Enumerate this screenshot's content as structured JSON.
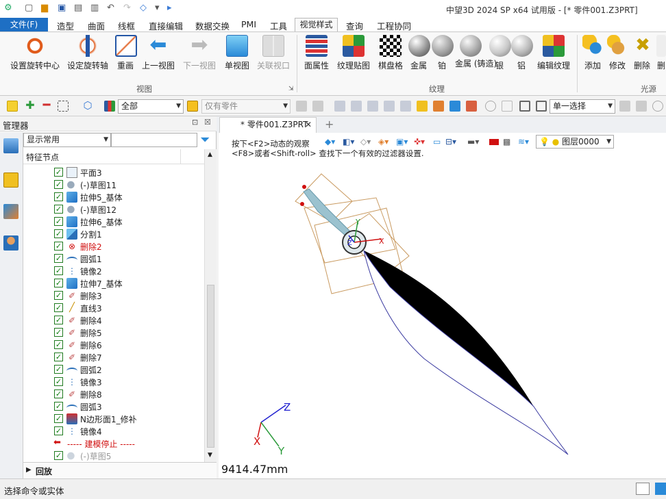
{
  "window": {
    "title": "中望3D 2024 SP x64 试用版 - [* 零件001.Z3PRT]"
  },
  "menu": {
    "file": "文件(F)",
    "items": [
      "造型",
      "曲面",
      "线框",
      "直接编辑",
      "数据交换",
      "PMI",
      "工具",
      "视觉样式",
      "查询",
      "工程协同"
    ],
    "active": "视觉样式"
  },
  "ribbon": {
    "view_group": {
      "label": "视图",
      "buttons": [
        "设置旋转中心",
        "设定旋转轴",
        "重画",
        "上一视图",
        "下一视图",
        "单视图",
        "关联视口"
      ]
    },
    "texture_group": {
      "label": "纹理",
      "buttons": [
        "面属性",
        "纹理贴图",
        "棋盘格",
        "金属",
        "铂",
        "金属 (铸造)",
        "银",
        "铝",
        "编辑纹理"
      ]
    },
    "light_group": {
      "label": "光源",
      "buttons": [
        "添加",
        "修改",
        "删除",
        "删"
      ]
    }
  },
  "toolbar": {
    "filter_value": "全部",
    "part_filter": "仅有零件",
    "select_mode": "单一选择"
  },
  "manager": {
    "title": "管理器",
    "display_filter": "显示常用",
    "tree_header": "特征节点",
    "nodes": [
      {
        "label": "平面3",
        "icon": "plane-icon",
        "red": false
      },
      {
        "label": "(-)草图11",
        "icon": "sketch-icon",
        "red": false
      },
      {
        "label": "拉伸5_基体",
        "icon": "extrude-icon",
        "red": false
      },
      {
        "label": "(-)草图12",
        "icon": "sketch-icon",
        "red": false
      },
      {
        "label": "拉伸6_基体",
        "icon": "extrude-icon",
        "red": false
      },
      {
        "label": "分割1",
        "icon": "split-icon",
        "red": false
      },
      {
        "label": "删除2",
        "icon": "delete-error-icon",
        "red": true
      },
      {
        "label": "圆弧1",
        "icon": "arc-icon",
        "red": false
      },
      {
        "label": "镜像2",
        "icon": "mirror-icon",
        "red": false
      },
      {
        "label": "拉伸7_基体",
        "icon": "extrude-icon",
        "red": false
      },
      {
        "label": "删除3",
        "icon": "delete-icon",
        "red": false
      },
      {
        "label": "直线3",
        "icon": "line-icon",
        "red": false
      },
      {
        "label": "删除4",
        "icon": "delete-icon",
        "red": false
      },
      {
        "label": "删除5",
        "icon": "delete-icon",
        "red": false
      },
      {
        "label": "删除6",
        "icon": "delete-icon",
        "red": false
      },
      {
        "label": "删除7",
        "icon": "delete-icon",
        "red": false
      },
      {
        "label": "圆弧2",
        "icon": "arc-icon",
        "red": false
      },
      {
        "label": "镜像3",
        "icon": "mirror-icon",
        "red": false
      },
      {
        "label": "删除8",
        "icon": "delete-icon",
        "red": false
      },
      {
        "label": "圆弧3",
        "icon": "arc-icon",
        "red": false
      },
      {
        "label": "N边形面1_修补",
        "icon": "nsided-patch-icon",
        "red": false
      },
      {
        "label": "镜像4",
        "icon": "mirror-icon",
        "red": false
      }
    ],
    "stop_marker": "----- 建模停止 -----",
    "after_stop": "(-)草图5",
    "replay": "回放"
  },
  "document": {
    "tab": "* 零件001.Z3PRT",
    "hint_line1": "按下<F2>动态的观察",
    "hint_line2": "<F8>或者<Shift-roll> 查找下一个有效的过滤器设置.",
    "layer": "图层0000",
    "measure": "9414.47mm"
  },
  "status": {
    "text": "选择命令或实体"
  },
  "colors": {
    "accent": "#1e6fc4",
    "error": "#d01010",
    "check": "#137f13"
  }
}
